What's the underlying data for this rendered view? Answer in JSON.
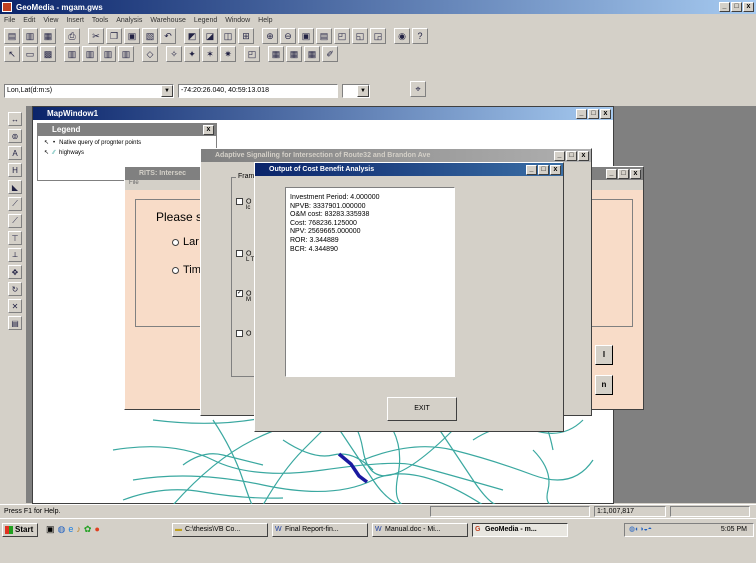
{
  "app": {
    "title": "GeoMedia - mgam.gws"
  },
  "menu": [
    "File",
    "Edit",
    "View",
    "Insert",
    "Tools",
    "Analysis",
    "Warehouse",
    "Legend",
    "Window",
    "Help"
  ],
  "coords": {
    "format": "Lon,Lat(d:m:s)",
    "value": "-74:20:26.040, 40:59:13.018"
  },
  "mapwindow": {
    "title": "MapWindow1"
  },
  "legend": {
    "title": "Legend",
    "items": [
      "Native query of prognter points",
      "highways"
    ]
  },
  "rits_dialog": {
    "title": "RITS: Intersec",
    "menu": "File",
    "prompt": "Please s",
    "options": [
      "Lar",
      "Tim"
    ]
  },
  "adaptive_dialog": {
    "title": "Adaptive Signalling for Intersection of Route32 and Brandon Ave",
    "frame_label": "Fram",
    "checkbox_fragments": [
      "O",
      "O",
      "O",
      "O"
    ],
    "checkbox_subtexts": [
      "lc",
      "L T",
      "M",
      ""
    ]
  },
  "output_dialog": {
    "title": "Output of Cost Benefit Analysis",
    "results": [
      "Investment Period: 4.000000",
      "NPVB: 3337901.000000",
      "O&M cost: 83283.335938",
      "Cost: 768236.125000",
      "NPV: 2569665.000000",
      "ROR: 3.344889",
      "BCR: 4.344890"
    ],
    "exit_label": "EXIT"
  },
  "status": {
    "help": "Press F1 for Help.",
    "scale": "1:1,007,817"
  },
  "taskbar": {
    "start": "Start",
    "tasks": [
      "C:\\thesis\\VB Co...",
      "Final Report-fin...",
      "Manual.doc - Mi...",
      "GeoMedia - m..."
    ],
    "time": "5:05 PM"
  },
  "colors": {
    "titlebar_active": "#0a246a",
    "rits_bg": "#f8dcc8",
    "chrome": "#d4d0c8",
    "roads": "#3aa8a0",
    "highlight": "#1a1aa0"
  }
}
